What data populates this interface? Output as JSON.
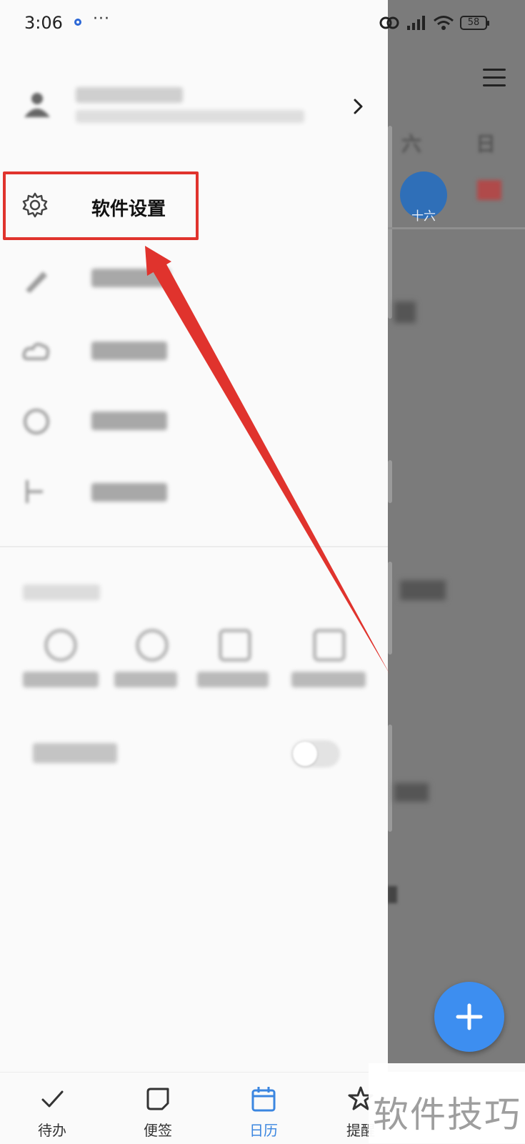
{
  "status_bar": {
    "time": "3:06",
    "more": "···",
    "battery": "58"
  },
  "background": {
    "weekday_labels": [
      "六",
      "日"
    ],
    "day_circle_label": "十六"
  },
  "drawer": {
    "settings_label": "软件设置"
  },
  "bottom_nav": {
    "items": [
      {
        "label": "待办",
        "icon": "check-icon",
        "active": false
      },
      {
        "label": "便签",
        "icon": "note-icon",
        "active": false
      },
      {
        "label": "日历",
        "icon": "calendar-icon",
        "active": true
      },
      {
        "label": "提醒",
        "icon": "star-icon",
        "active": false
      }
    ]
  },
  "watermark": {
    "text": "软件技巧"
  },
  "colors": {
    "accent": "#3d8ef0",
    "active_nav": "#3b86e0",
    "highlight": "#e0332d"
  }
}
